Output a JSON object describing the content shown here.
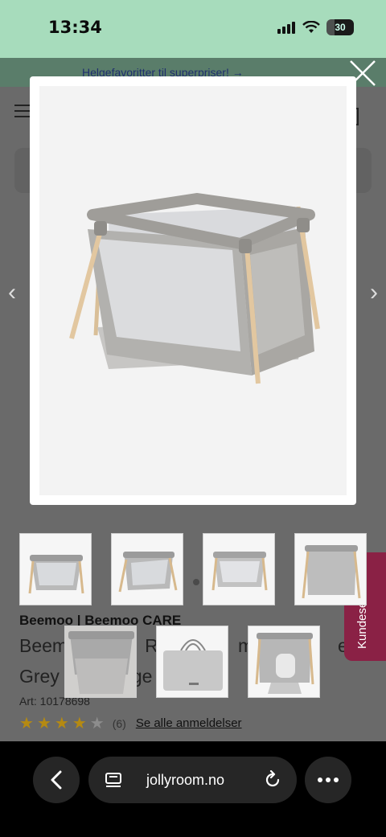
{
  "status": {
    "time": "13:34",
    "battery": "30"
  },
  "page": {
    "promo": "Helgefavoritter til superpriser! →",
    "brand": "Beemoo | Beemoo CARE",
    "title_line1": "Beem",
    "title_line1_mid": "RE",
    "title_line1_mid2": "me",
    "title_line1_end": "en",
    "title_line2": "Grey",
    "title_line2_end": "ge",
    "art_label": "Art:",
    "art_number": "10178698",
    "rating_value": 4,
    "rating_max": 5,
    "rating_count": "(6)",
    "reviews_link": "Se alle anmeldelser",
    "customer_service": "Kundeservice"
  },
  "colors": {
    "status_bg": "#a7dcbc",
    "accent": "#8a2145",
    "star": "#b58a12"
  },
  "browser": {
    "url": "jollyroom.no"
  }
}
